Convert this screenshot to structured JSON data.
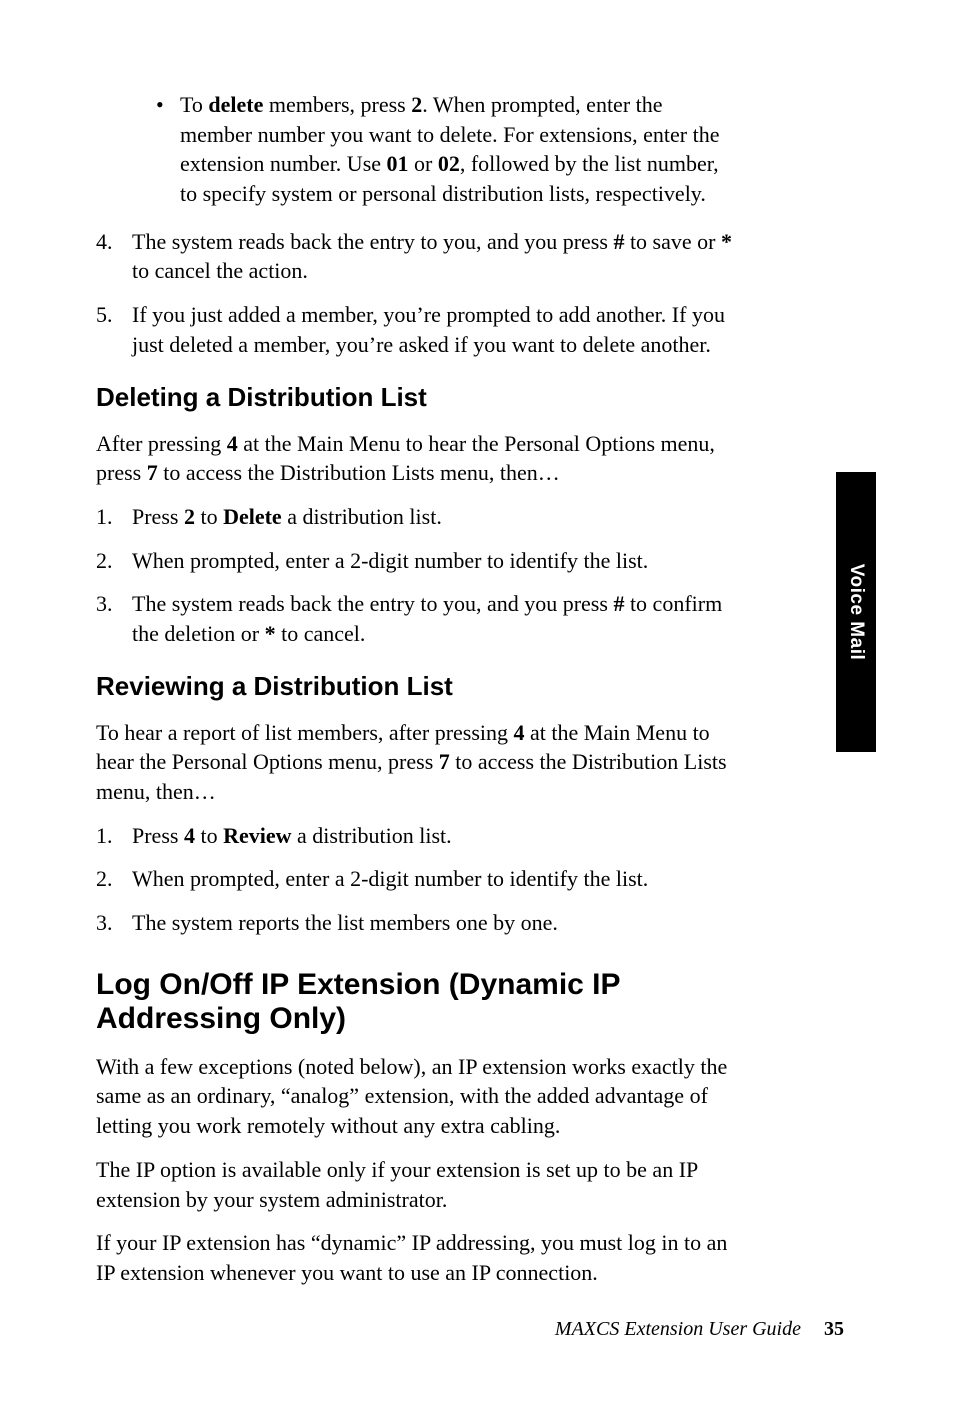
{
  "bullet1": {
    "pre": "To ",
    "b1": "delete",
    "mid1": " members, press ",
    "b2": "2",
    "mid2": ". When prompted, enter the member number you want to delete. For extensions, enter the extension number. Use ",
    "b3": "01",
    "mid3": " or ",
    "b4": "02",
    "post": ", followed by the list number, to specify system or personal distribution lists, respectively."
  },
  "step4": {
    "num": "4.",
    "pre": "The system reads back the entry to you, and you press ",
    "b1": "#",
    "mid1": " to save or ",
    "b2": "*",
    "post": " to cancel the action."
  },
  "step5": {
    "num": "5.",
    "text": "If you just added a member, you’re prompted to add another. If you just deleted a member, you’re asked if you want to delete another."
  },
  "h2a": "Deleting a Distribution List",
  "paraA": {
    "pre": "After pressing ",
    "b1": "4",
    "mid1": " at the Main Menu to hear the Personal Options menu, press ",
    "b2": "7",
    "post": " to access the Distribution Lists menu, then…"
  },
  "listA": {
    "i1": {
      "num": "1.",
      "pre": "Press ",
      "b1": "2",
      "mid": " to ",
      "b2": "Delete",
      "post": " a distribution list."
    },
    "i2": {
      "num": "2.",
      "text": "When prompted, enter a 2-digit number to identify the list."
    },
    "i3": {
      "num": "3.",
      "pre": "The system reads back the entry to you, and you press ",
      "b1": "#",
      "mid": " to confirm the deletion or ",
      "b2": "*",
      "post": " to cancel."
    }
  },
  "h2b": "Reviewing a Distribution List",
  "paraB": {
    "pre": "To hear a report of list members, after pressing ",
    "b1": "4",
    "mid1": " at the Main Menu to hear the Personal Options menu, press ",
    "b2": "7",
    "post": " to access the Distribution Lists menu, then…"
  },
  "listB": {
    "i1": {
      "num": "1.",
      "pre": "Press ",
      "b1": "4",
      "mid": " to ",
      "b2": "Review",
      "post": " a distribution list."
    },
    "i2": {
      "num": "2.",
      "text": "When prompted, enter a 2-digit number to identify the list."
    },
    "i3": {
      "num": "3.",
      "text": "The system reports the list members one by one."
    }
  },
  "h1": "Log On/Off IP Extension (Dynamic IP Addressing Only)",
  "paraC1": "With a few exceptions (noted below), an IP extension works exactly the same as an ordinary, “analog” extension, with the added advantage of letting you work remotely without any extra cabling.",
  "paraC2": "The IP option is available only if your extension is set up to be an IP extension by your system administrator.",
  "paraC3": "If your IP extension has “dynamic” IP addressing, you must log in to an IP extension whenever you want to use an IP connection.",
  "sideTab": "Voice Mail",
  "footer": {
    "title": "MAXCS Extension User Guide",
    "page": "35"
  }
}
